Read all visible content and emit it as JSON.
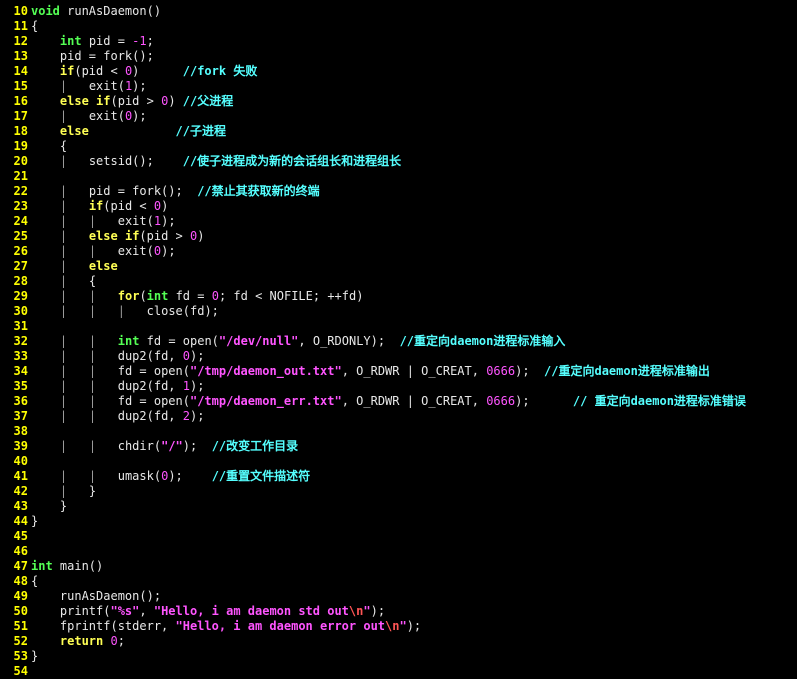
{
  "editor": {
    "lines": [
      {
        "n": "10",
        "tokens": [
          [
            "ty",
            "void"
          ],
          [
            "pl",
            " runAsDaemon()"
          ]
        ]
      },
      {
        "n": "11",
        "tokens": [
          [
            "pl",
            "{"
          ]
        ]
      },
      {
        "n": "12",
        "tokens": [
          [
            "pl",
            "    "
          ],
          [
            "ty",
            "int"
          ],
          [
            "pl",
            " pid = "
          ],
          [
            "num",
            "-1"
          ],
          [
            "pl",
            ";"
          ]
        ]
      },
      {
        "n": "13",
        "tokens": [
          [
            "pl",
            "    pid = fork();"
          ]
        ]
      },
      {
        "n": "14",
        "tokens": [
          [
            "pl",
            "    "
          ],
          [
            "kw",
            "if"
          ],
          [
            "pl",
            "(pid < "
          ],
          [
            "num",
            "0"
          ],
          [
            "pl",
            ")      "
          ],
          [
            "cm",
            "//fork 失败"
          ]
        ]
      },
      {
        "n": "15",
        "tokens": [
          [
            "pl",
            "    "
          ],
          [
            "gd",
            "|"
          ],
          [
            "pl",
            "   exit("
          ],
          [
            "num",
            "1"
          ],
          [
            "pl",
            ");"
          ]
        ]
      },
      {
        "n": "16",
        "tokens": [
          [
            "pl",
            "    "
          ],
          [
            "kw",
            "else"
          ],
          [
            "pl",
            " "
          ],
          [
            "kw",
            "if"
          ],
          [
            "pl",
            "(pid > "
          ],
          [
            "num",
            "0"
          ],
          [
            "pl",
            ") "
          ],
          [
            "cm",
            "//父进程"
          ]
        ]
      },
      {
        "n": "17",
        "tokens": [
          [
            "pl",
            "    "
          ],
          [
            "gd",
            "|"
          ],
          [
            "pl",
            "   exit("
          ],
          [
            "num",
            "0"
          ],
          [
            "pl",
            ");"
          ]
        ]
      },
      {
        "n": "18",
        "tokens": [
          [
            "pl",
            "    "
          ],
          [
            "kw",
            "else"
          ],
          [
            "pl",
            "            "
          ],
          [
            "cm",
            "//子进程"
          ]
        ]
      },
      {
        "n": "19",
        "tokens": [
          [
            "pl",
            "    {"
          ]
        ]
      },
      {
        "n": "20",
        "tokens": [
          [
            "pl",
            "    "
          ],
          [
            "gd",
            "|"
          ],
          [
            "pl",
            "   setsid();    "
          ],
          [
            "cm",
            "//使子进程成为新的会话组长和进程组长"
          ]
        ]
      },
      {
        "n": "21",
        "tokens": []
      },
      {
        "n": "22",
        "tokens": [
          [
            "pl",
            "    "
          ],
          [
            "gd",
            "|"
          ],
          [
            "pl",
            "   pid = fork();  "
          ],
          [
            "cm",
            "//禁止其获取新的终端"
          ]
        ]
      },
      {
        "n": "23",
        "tokens": [
          [
            "pl",
            "    "
          ],
          [
            "gd",
            "|"
          ],
          [
            "pl",
            "   "
          ],
          [
            "kw",
            "if"
          ],
          [
            "pl",
            "(pid < "
          ],
          [
            "num",
            "0"
          ],
          [
            "pl",
            ")"
          ]
        ]
      },
      {
        "n": "24",
        "tokens": [
          [
            "pl",
            "    "
          ],
          [
            "gd",
            "|"
          ],
          [
            "pl",
            "   "
          ],
          [
            "gd",
            "|"
          ],
          [
            "pl",
            "   exit("
          ],
          [
            "num",
            "1"
          ],
          [
            "pl",
            ");"
          ]
        ]
      },
      {
        "n": "25",
        "tokens": [
          [
            "pl",
            "    "
          ],
          [
            "gd",
            "|"
          ],
          [
            "pl",
            "   "
          ],
          [
            "kw",
            "else"
          ],
          [
            "pl",
            " "
          ],
          [
            "kw",
            "if"
          ],
          [
            "pl",
            "(pid > "
          ],
          [
            "num",
            "0"
          ],
          [
            "pl",
            ")"
          ]
        ]
      },
      {
        "n": "26",
        "tokens": [
          [
            "pl",
            "    "
          ],
          [
            "gd",
            "|"
          ],
          [
            "pl",
            "   "
          ],
          [
            "gd",
            "|"
          ],
          [
            "pl",
            "   exit("
          ],
          [
            "num",
            "0"
          ],
          [
            "pl",
            ");"
          ]
        ]
      },
      {
        "n": "27",
        "tokens": [
          [
            "pl",
            "    "
          ],
          [
            "gd",
            "|"
          ],
          [
            "pl",
            "   "
          ],
          [
            "kw",
            "else"
          ]
        ]
      },
      {
        "n": "28",
        "tokens": [
          [
            "pl",
            "    "
          ],
          [
            "gd",
            "|"
          ],
          [
            "pl",
            "   {"
          ]
        ]
      },
      {
        "n": "29",
        "tokens": [
          [
            "pl",
            "    "
          ],
          [
            "gd",
            "|"
          ],
          [
            "pl",
            "   "
          ],
          [
            "gd",
            "|"
          ],
          [
            "pl",
            "   "
          ],
          [
            "kw",
            "for"
          ],
          [
            "pl",
            "("
          ],
          [
            "ty",
            "int"
          ],
          [
            "pl",
            " fd = "
          ],
          [
            "num",
            "0"
          ],
          [
            "pl",
            "; fd < NOFILE; ++fd)"
          ]
        ]
      },
      {
        "n": "30",
        "tokens": [
          [
            "pl",
            "    "
          ],
          [
            "gd",
            "|"
          ],
          [
            "pl",
            "   "
          ],
          [
            "gd",
            "|"
          ],
          [
            "pl",
            "   "
          ],
          [
            "gd",
            "|"
          ],
          [
            "pl",
            "   close(fd);"
          ]
        ]
      },
      {
        "n": "31",
        "tokens": []
      },
      {
        "n": "32",
        "tokens": [
          [
            "pl",
            "    "
          ],
          [
            "gd",
            "|"
          ],
          [
            "pl",
            "   "
          ],
          [
            "gd",
            "|"
          ],
          [
            "pl",
            "   "
          ],
          [
            "ty",
            "int"
          ],
          [
            "pl",
            " fd = open("
          ],
          [
            "str",
            "\"/dev/null\""
          ],
          [
            "pl",
            ", O_RDONLY);  "
          ],
          [
            "cm",
            "//重定向daemon进程标准输入"
          ]
        ]
      },
      {
        "n": "33",
        "tokens": [
          [
            "pl",
            "    "
          ],
          [
            "gd",
            "|"
          ],
          [
            "pl",
            "   "
          ],
          [
            "gd",
            "|"
          ],
          [
            "pl",
            "   dup2(fd, "
          ],
          [
            "num",
            "0"
          ],
          [
            "pl",
            ");"
          ]
        ]
      },
      {
        "n": "34",
        "tokens": [
          [
            "pl",
            "    "
          ],
          [
            "gd",
            "|"
          ],
          [
            "pl",
            "   "
          ],
          [
            "gd",
            "|"
          ],
          [
            "pl",
            "   fd = open("
          ],
          [
            "str",
            "\"/tmp/daemon_out.txt\""
          ],
          [
            "pl",
            ", O_RDWR | O_CREAT, "
          ],
          [
            "num",
            "0666"
          ],
          [
            "pl",
            ");  "
          ],
          [
            "cm",
            "//重定向daemon进程标准输出"
          ]
        ]
      },
      {
        "n": "35",
        "tokens": [
          [
            "pl",
            "    "
          ],
          [
            "gd",
            "|"
          ],
          [
            "pl",
            "   "
          ],
          [
            "gd",
            "|"
          ],
          [
            "pl",
            "   dup2(fd, "
          ],
          [
            "num",
            "1"
          ],
          [
            "pl",
            ");"
          ]
        ]
      },
      {
        "n": "36",
        "tokens": [
          [
            "pl",
            "    "
          ],
          [
            "gd",
            "|"
          ],
          [
            "pl",
            "   "
          ],
          [
            "gd",
            "|"
          ],
          [
            "pl",
            "   fd = open("
          ],
          [
            "str",
            "\"/tmp/daemon_err.txt\""
          ],
          [
            "pl",
            ", O_RDWR | O_CREAT, "
          ],
          [
            "num",
            "0666"
          ],
          [
            "pl",
            ");      "
          ],
          [
            "cm",
            "// 重定向daemon进程标准错误"
          ]
        ]
      },
      {
        "n": "37",
        "tokens": [
          [
            "pl",
            "    "
          ],
          [
            "gd",
            "|"
          ],
          [
            "pl",
            "   "
          ],
          [
            "gd",
            "|"
          ],
          [
            "pl",
            "   dup2(fd, "
          ],
          [
            "num",
            "2"
          ],
          [
            "pl",
            ");"
          ]
        ]
      },
      {
        "n": "38",
        "tokens": []
      },
      {
        "n": "39",
        "tokens": [
          [
            "pl",
            "    "
          ],
          [
            "gd",
            "|"
          ],
          [
            "pl",
            "   "
          ],
          [
            "gd",
            "|"
          ],
          [
            "pl",
            "   chdir("
          ],
          [
            "str",
            "\"/\""
          ],
          [
            "pl",
            ");  "
          ],
          [
            "cm",
            "//改变工作目录"
          ]
        ]
      },
      {
        "n": "40",
        "tokens": []
      },
      {
        "n": "41",
        "tokens": [
          [
            "pl",
            "    "
          ],
          [
            "gd",
            "|"
          ],
          [
            "pl",
            "   "
          ],
          [
            "gd",
            "|"
          ],
          [
            "pl",
            "   umask("
          ],
          [
            "num",
            "0"
          ],
          [
            "pl",
            ");    "
          ],
          [
            "cm",
            "//重置文件描述符"
          ]
        ]
      },
      {
        "n": "42",
        "tokens": [
          [
            "pl",
            "    "
          ],
          [
            "gd",
            "|"
          ],
          [
            "pl",
            "   }"
          ]
        ]
      },
      {
        "n": "43",
        "tokens": [
          [
            "pl",
            "    }"
          ]
        ]
      },
      {
        "n": "44",
        "tokens": [
          [
            "pl",
            "}"
          ]
        ]
      },
      {
        "n": "45",
        "tokens": []
      },
      {
        "n": "46",
        "tokens": []
      },
      {
        "n": "47",
        "tokens": [
          [
            "ty",
            "int"
          ],
          [
            "pl",
            " main()"
          ]
        ]
      },
      {
        "n": "48",
        "tokens": [
          [
            "pl",
            "{"
          ]
        ]
      },
      {
        "n": "49",
        "tokens": [
          [
            "pl",
            "    runAsDaemon();"
          ]
        ]
      },
      {
        "n": "50",
        "tokens": [
          [
            "pl",
            "    printf("
          ],
          [
            "str",
            "\"%s\""
          ],
          [
            "pl",
            ", "
          ],
          [
            "str",
            "\"Hello, i am daemon std out"
          ],
          [
            "esc",
            "\\n"
          ],
          [
            "str",
            "\""
          ],
          [
            "pl",
            ");"
          ]
        ]
      },
      {
        "n": "51",
        "tokens": [
          [
            "pl",
            "    fprintf(stderr, "
          ],
          [
            "str",
            "\"Hello, i am daemon error out"
          ],
          [
            "esc",
            "\\n"
          ],
          [
            "str",
            "\""
          ],
          [
            "pl",
            ");"
          ]
        ]
      },
      {
        "n": "52",
        "tokens": [
          [
            "pl",
            "    "
          ],
          [
            "kw",
            "return"
          ],
          [
            "pl",
            " "
          ],
          [
            "num",
            "0"
          ],
          [
            "pl",
            ";"
          ]
        ]
      },
      {
        "n": "53",
        "tokens": [
          [
            "pl",
            "}"
          ]
        ]
      },
      {
        "n": "54",
        "tokens": []
      }
    ]
  },
  "colors": {
    "background": "#000000",
    "line_number": "#ffff00",
    "keyword": "#ffff54",
    "type": "#54ff54",
    "number": "#ff55ff",
    "string": "#ff55ff",
    "comment": "#55ffff",
    "plain": "#e8e8e8"
  }
}
